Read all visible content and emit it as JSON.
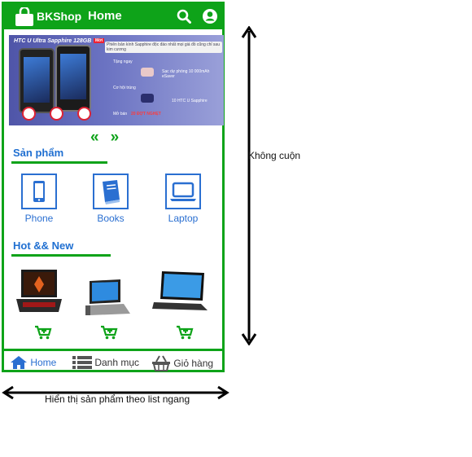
{
  "app": {
    "brand": "BKShop",
    "title": "Home"
  },
  "banner": {
    "headline": "HTC U Ultra Sapphire 128GB",
    "intro": "Phiên bản kính Sapphire độc đáo nhất mọi giá đồ cũng chỉ sau kim cương",
    "gift_label": "Tặng ngay",
    "gift_item": "Sạc dự phòng 10 000mAh eSaver",
    "chance_label": "Cơ hội trúng",
    "chance_item": "10 HTC U Sapphire",
    "sale_label": "Mở bán",
    "sale_value": "20 ĐỢT NGHẸT",
    "sticker": "Mới"
  },
  "carousel": {
    "prev": "«",
    "next": "»"
  },
  "categories": {
    "title": "Sản phẩm",
    "items": [
      {
        "label": "Phone",
        "icon": "phone-icon"
      },
      {
        "label": "Books",
        "icon": "book-icon"
      },
      {
        "label": "Laptop",
        "icon": "laptop-icon"
      }
    ]
  },
  "hot": {
    "title": "Hot && New",
    "products": [
      {
        "icon": "gaming-laptop-image"
      },
      {
        "icon": "convertible-laptop-image"
      },
      {
        "icon": "tent-laptop-image"
      }
    ]
  },
  "bottom_nav": {
    "items": [
      {
        "label": "Home",
        "icon": "home-icon"
      },
      {
        "label": "Danh mục",
        "icon": "list-icon"
      },
      {
        "label": "Giỏ hàng",
        "icon": "basket-icon"
      }
    ]
  },
  "annotations": {
    "vertical": "Không cuộn",
    "horizontal": "Hiển thị sản phẩm theo list ngang"
  },
  "colors": {
    "primary": "#0ea319",
    "accent": "#2a6fd1"
  }
}
